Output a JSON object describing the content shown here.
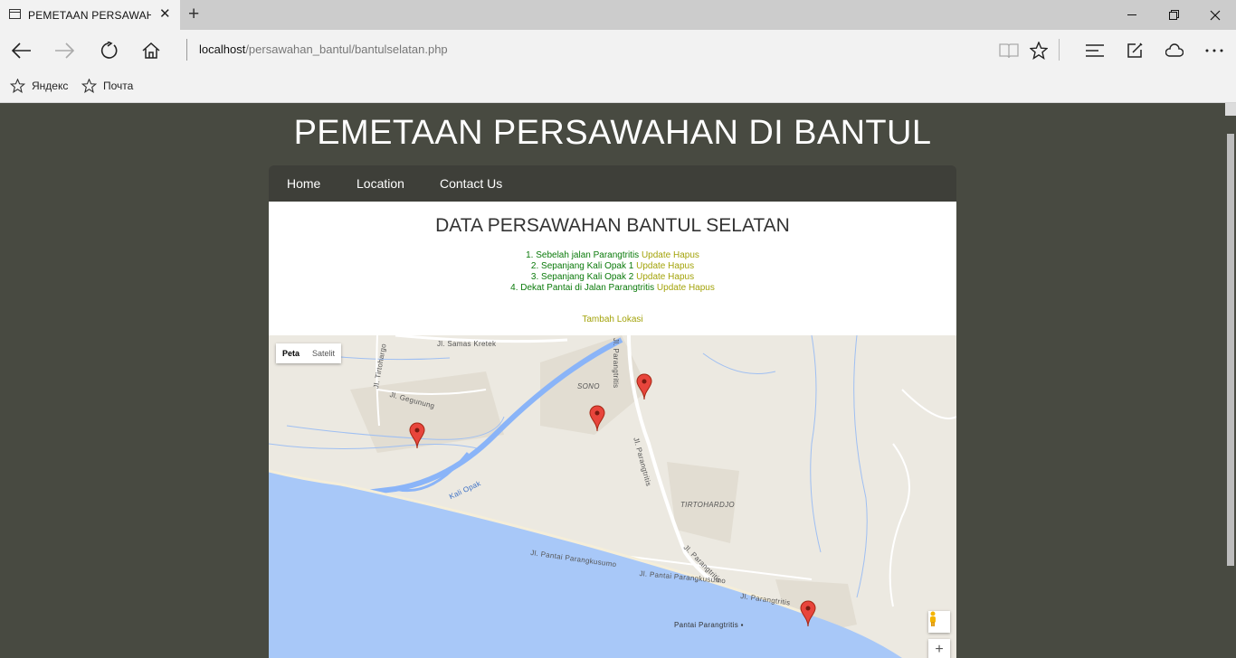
{
  "browser": {
    "tab_title": "PEMETAAN PERSAWAHAN DI BANTUL",
    "url_host": "localhost",
    "url_path": "/persawahan_bantul/bantulselatan.php",
    "favorites": [
      {
        "label": "Яндекс"
      },
      {
        "label": "Почта"
      }
    ]
  },
  "site": {
    "title": "PEMETAAN PERSAWAHAN DI BANTUL",
    "menu": [
      "Home",
      "Location",
      "Contact Us"
    ]
  },
  "content": {
    "title": "DATA PERSAWAHAN BANTUL SELATAN",
    "locations": [
      {
        "name": "1. Sebelah jalan Parangtritis",
        "update": "Update",
        "delete": "Hapus"
      },
      {
        "name": "2. Sepanjang Kali Opak 1",
        "update": "Update",
        "delete": "Hapus"
      },
      {
        "name": "3. Sepanjang Kali Opak 2",
        "update": "Update",
        "delete": "Hapus"
      },
      {
        "name": "4. Dekat Pantai di Jalan Parangtritis",
        "update": "Update",
        "delete": "Hapus"
      }
    ],
    "add_label": "Tambah Lokasi"
  },
  "map": {
    "type_options": [
      "Peta",
      "Satelit"
    ],
    "selected_type": "Peta",
    "zoom_in": "+",
    "labels": {
      "samas": "Jl. Samas Kretek",
      "parangtritis_top": "Jl. Parangtritis",
      "tirtohargo": "Jl. Tirtohargo",
      "gegunung": "Jl. Gegunung",
      "sono": "SONO",
      "parangtritis_mid": "Jl. Parangtritis",
      "kali_opak": "Kali Opak",
      "tirtohardjo": "TIRTOHARDJO",
      "parangkusumo1": "Jl. Pantai Parangkusumo",
      "parangkusumo2": "Jl. Pantai Parangkusumo",
      "parangtritis_low": "Jl. Parangtritis",
      "parangtritis_bottom": "Jl. Parangtritis",
      "pantai": "Pantai Parangtritis"
    },
    "colors": {
      "water": "#a8c8f8",
      "land": "#ece9e1",
      "marker": "#e8453c"
    }
  }
}
